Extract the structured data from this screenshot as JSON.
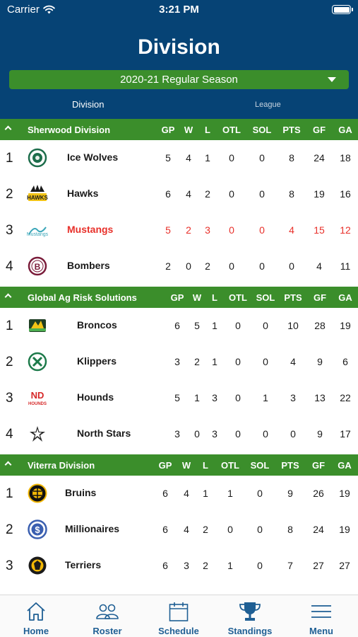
{
  "status_bar": {
    "carrier": "Carrier",
    "time": "3:21 PM"
  },
  "header": {
    "title": "Division",
    "season": "2020-21 Regular Season"
  },
  "tabs": {
    "division": "Division",
    "league": "League"
  },
  "columns": [
    "GP",
    "W",
    "L",
    "OTL",
    "SOL",
    "PTS",
    "GF",
    "GA"
  ],
  "divisions": [
    {
      "name": "Sherwood Division",
      "teams": [
        {
          "rank": "1",
          "name": "Ice Wolves",
          "logo": "ice-wolves-logo",
          "stats": [
            "5",
            "4",
            "1",
            "0",
            "0",
            "8",
            "24",
            "18"
          ]
        },
        {
          "rank": "2",
          "name": "Hawks",
          "logo": "hawks-logo",
          "stats": [
            "6",
            "4",
            "2",
            "0",
            "0",
            "8",
            "19",
            "16"
          ]
        },
        {
          "rank": "3",
          "name": "Mustangs",
          "logo": "mustangs-logo",
          "highlight": true,
          "stats": [
            "5",
            "2",
            "3",
            "0",
            "0",
            "4",
            "15",
            "12"
          ]
        },
        {
          "rank": "4",
          "name": "Bombers",
          "logo": "bombers-logo",
          "stats": [
            "2",
            "0",
            "2",
            "0",
            "0",
            "0",
            "4",
            "11"
          ]
        }
      ]
    },
    {
      "name": "Global Ag Risk Solutions",
      "teams": [
        {
          "rank": "1",
          "name": "Broncos",
          "logo": "broncos-logo",
          "stats": [
            "6",
            "5",
            "1",
            "0",
            "0",
            "10",
            "28",
            "19"
          ]
        },
        {
          "rank": "2",
          "name": "Klippers",
          "logo": "klippers-logo",
          "stats": [
            "3",
            "2",
            "1",
            "0",
            "0",
            "4",
            "9",
            "6"
          ]
        },
        {
          "rank": "3",
          "name": "Hounds",
          "logo": "hounds-logo",
          "stats": [
            "5",
            "1",
            "3",
            "0",
            "1",
            "3",
            "13",
            "22"
          ]
        },
        {
          "rank": "4",
          "name": "North Stars",
          "logo": "north-stars-logo",
          "stats": [
            "3",
            "0",
            "3",
            "0",
            "0",
            "0",
            "9",
            "17"
          ]
        }
      ]
    },
    {
      "name": "Viterra Division",
      "teams": [
        {
          "rank": "1",
          "name": "Bruins",
          "logo": "bruins-logo",
          "stats": [
            "6",
            "4",
            "1",
            "1",
            "0",
            "9",
            "26",
            "19"
          ]
        },
        {
          "rank": "2",
          "name": "Millionaires",
          "logo": "millionaires-logo",
          "stats": [
            "6",
            "4",
            "2",
            "0",
            "0",
            "8",
            "24",
            "19"
          ]
        },
        {
          "rank": "3",
          "name": "Terriers",
          "logo": "terriers-logo",
          "stats": [
            "6",
            "3",
            "2",
            "1",
            "0",
            "7",
            "27",
            "27"
          ]
        }
      ]
    }
  ],
  "logo_text": {
    "hawks": "HAWKS",
    "hounds_top": "ND",
    "hounds_bottom": "HOUNDS",
    "mustangs": "Mustangs",
    "bombers": "B",
    "millionaires": "$"
  },
  "tab_bar": [
    {
      "label": "Home",
      "icon": "home-icon"
    },
    {
      "label": "Roster",
      "icon": "roster-icon"
    },
    {
      "label": "Schedule",
      "icon": "calendar-icon"
    },
    {
      "label": "Standings",
      "icon": "trophy-icon"
    },
    {
      "label": "Menu",
      "icon": "menu-icon"
    }
  ],
  "colors": {
    "header": "#064375",
    "accent_green": "#3b8e2b",
    "highlight_red": "#e8302a",
    "tab_label": "#1f5f94"
  }
}
